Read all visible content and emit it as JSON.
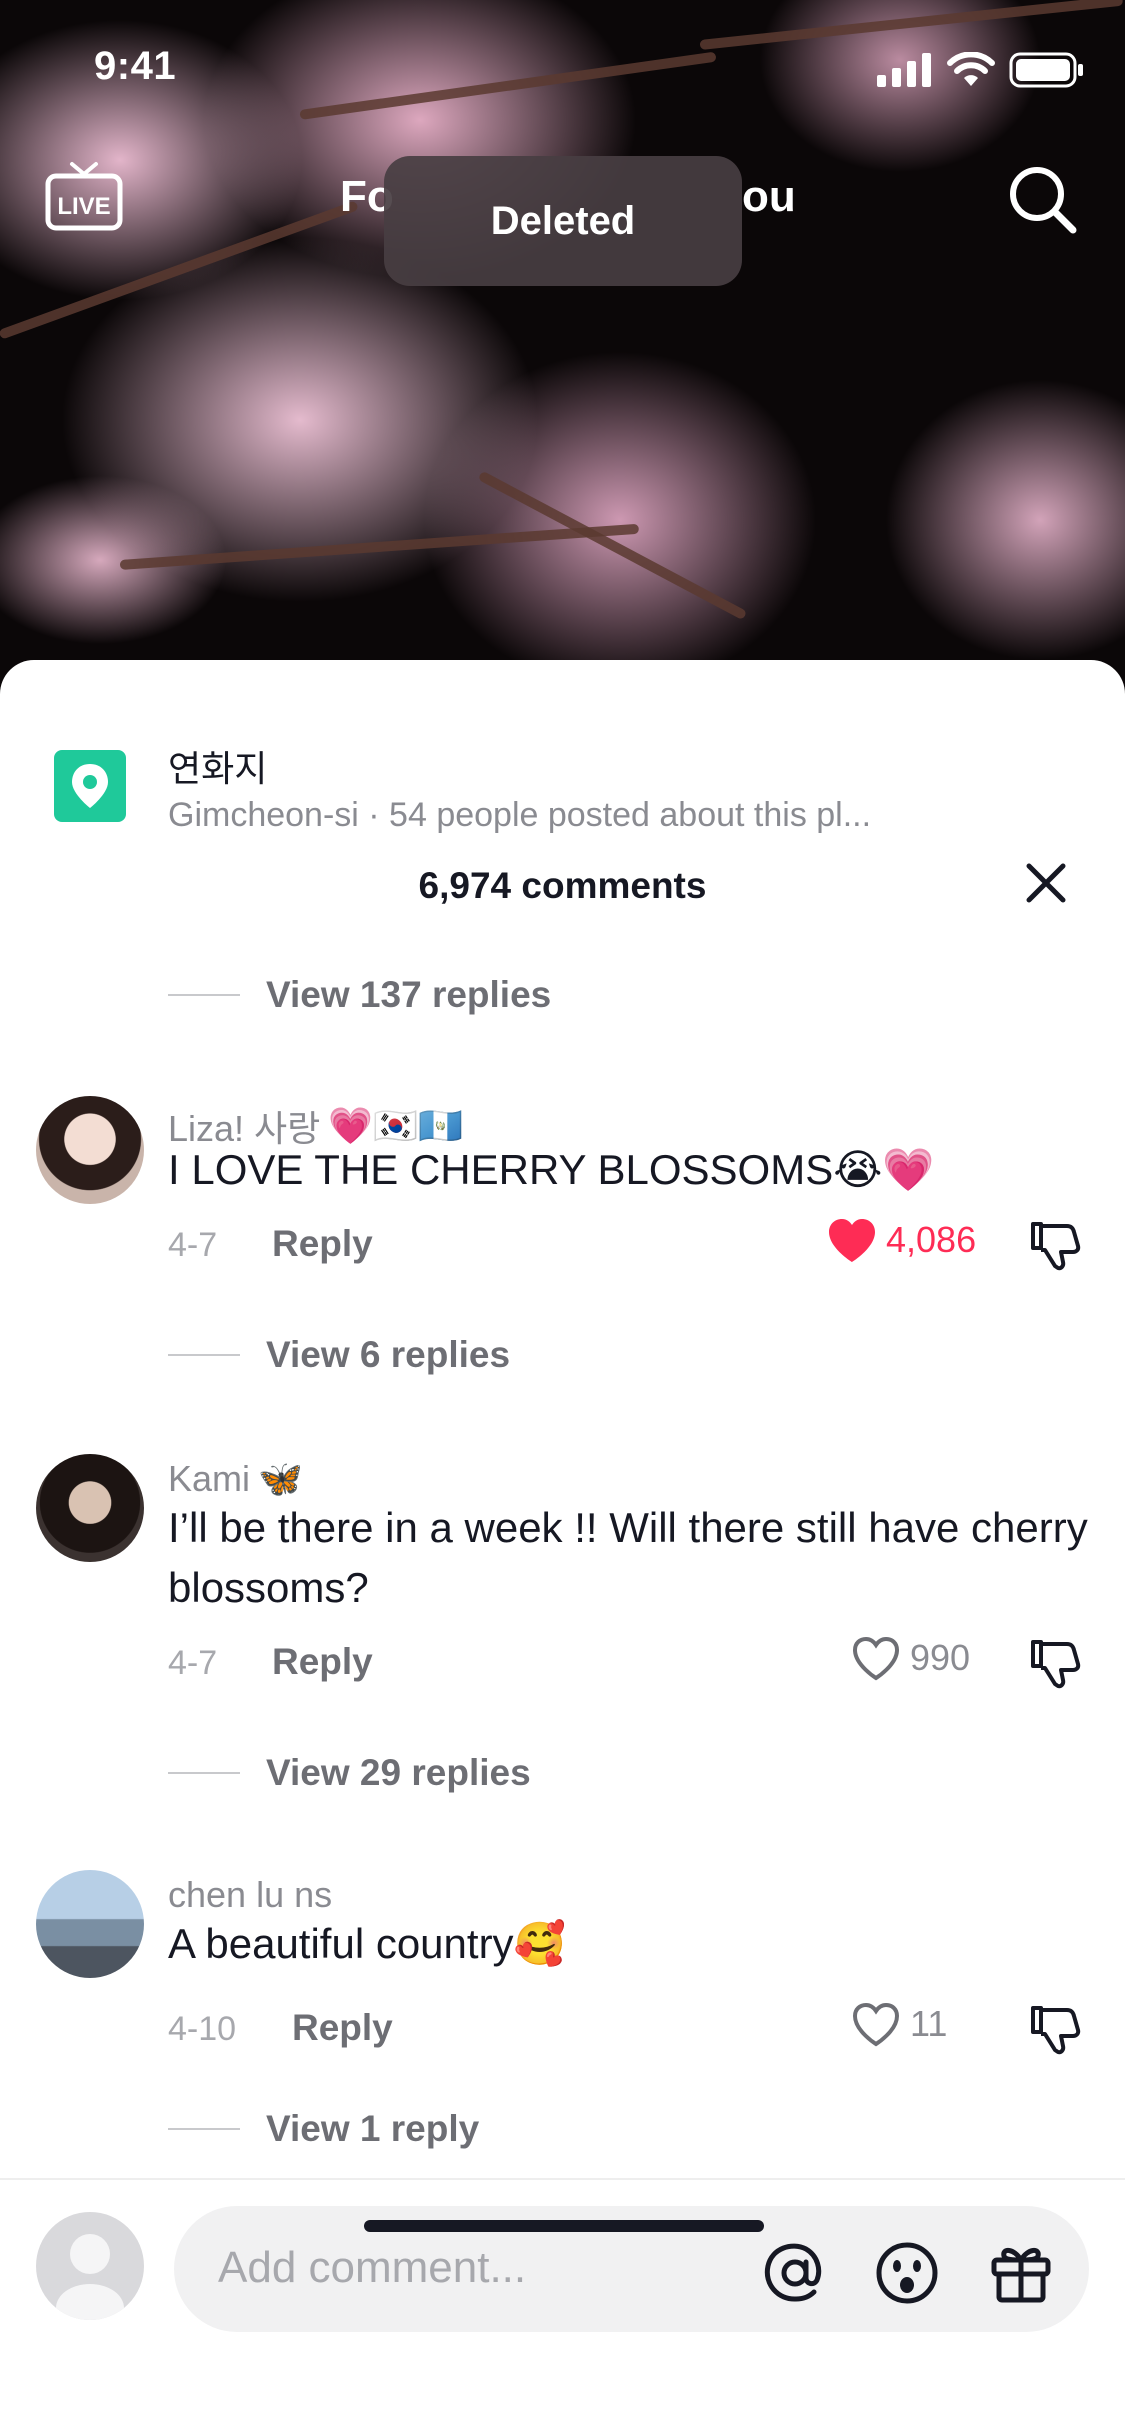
{
  "status_bar": {
    "time": "9:41"
  },
  "nav": {
    "left_peek": "Fo",
    "right_peek": "ou"
  },
  "toast": "Deleted",
  "place": {
    "name": "연화지",
    "subtitle": "Gimcheon-si · 54 people posted about this pl..."
  },
  "comments_header": "6,974 comments",
  "top_view_replies": "View 137 replies",
  "comments": [
    {
      "username": "Liza! 사랑",
      "username_emojis": "💗🇰🇷🇬🇹",
      "text": "I LOVE THE CHERRY BLOSSOMS😭💗",
      "date": "4-7",
      "reply_label": "Reply",
      "likes": "4,086",
      "liked": true,
      "view_replies": "View 6 replies"
    },
    {
      "username": "Kami",
      "username_emojis": "🦋",
      "text": "I’ll be there in a week !! Will there still have cherry blossoms?",
      "date": "4-7",
      "reply_label": "Reply",
      "likes": "990",
      "liked": false,
      "view_replies": "View 29 replies"
    },
    {
      "username": "chen lu ns",
      "username_emojis": "",
      "text": "A beautiful country🥰",
      "date": "4-10",
      "reply_label": "Reply",
      "likes": "11",
      "liked": false,
      "view_replies": "View 1 reply"
    }
  ],
  "input": {
    "placeholder": "Add comment..."
  },
  "colors": {
    "accent_like": "#fe2c55",
    "pin_green": "#1fc99a",
    "text_primary": "#161823",
    "text_secondary": "#8a8b91"
  }
}
